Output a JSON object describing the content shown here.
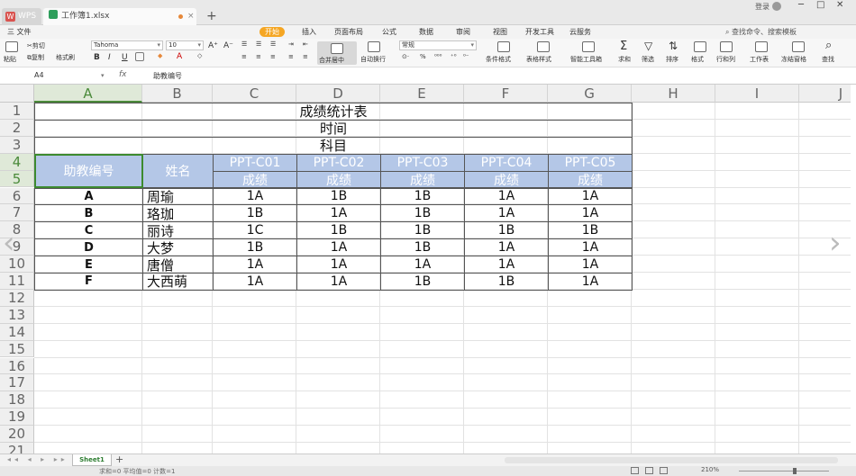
{
  "titlebar": {
    "app_tab": "WPS",
    "doc_tab": "工作簿1.xlsx",
    "login": "登录",
    "new_tab": "+"
  },
  "menu": {
    "file": "三 文件",
    "items": [
      "开始",
      "插入",
      "页面布局",
      "公式",
      "数据",
      "审阅",
      "视图",
      "开发工具",
      "云服务"
    ],
    "active": "开始",
    "search": "查找命令、搜索模板"
  },
  "toolbar": {
    "paste": "粘贴",
    "cut": "剪切",
    "copy": "复制",
    "format_painter": "格式刷",
    "font_name": "Tahoma",
    "font_size": "10",
    "merge_center": "合并居中",
    "wrap_text": "自动换行",
    "number_format": "常规",
    "cond_format": "条件格式",
    "table_style": "表格样式",
    "smart_tools": "智能工具箱",
    "sum": "求和",
    "filter": "筛选",
    "sort": "排序",
    "format": "格式",
    "rows_cols": "行和列",
    "worksheet": "工作表",
    "freeze": "冻结窗格",
    "find": "查找"
  },
  "formula_bar": {
    "cell_ref": "A4",
    "fx": "fx",
    "content": "助教编号"
  },
  "columns": [
    "A",
    "B",
    "C",
    "D",
    "E",
    "F",
    "G",
    "H",
    "I",
    "J"
  ],
  "selected_column": "A",
  "rows": [
    "1",
    "2",
    "3",
    "4",
    "5",
    "6",
    "7",
    "8",
    "9",
    "10",
    "11",
    "12",
    "13",
    "14",
    "15",
    "16",
    "17",
    "18",
    "19",
    "20",
    "21"
  ],
  "selected_rows": [
    "4",
    "5"
  ],
  "sheet": {
    "title": "成绩统计表",
    "time_label": "时间",
    "subject_label": "科目",
    "id_header": "助教编号",
    "name_header": "姓名",
    "courses": [
      "PPT-C01",
      "PPT-C02",
      "PPT-C03",
      "PPT-C04",
      "PPT-C05"
    ],
    "score_label": "成绩",
    "records": [
      {
        "id": "A",
        "name": "周瑜",
        "scores": [
          "1A",
          "1B",
          "1B",
          "1A",
          "1A"
        ]
      },
      {
        "id": "B",
        "name": "珞珈",
        "scores": [
          "1B",
          "1A",
          "1B",
          "1A",
          "1A"
        ]
      },
      {
        "id": "C",
        "name": "丽诗",
        "scores": [
          "1C",
          "1B",
          "1B",
          "1B",
          "1B"
        ]
      },
      {
        "id": "D",
        "name": "大梦",
        "scores": [
          "1B",
          "1A",
          "1B",
          "1A",
          "1A"
        ]
      },
      {
        "id": "E",
        "name": "唐僧",
        "scores": [
          "1A",
          "1A",
          "1A",
          "1A",
          "1A"
        ]
      },
      {
        "id": "F",
        "name": "大西萌",
        "scores": [
          "1A",
          "1A",
          "1B",
          "1B",
          "1A"
        ]
      }
    ]
  },
  "sheet_tabs": {
    "active": "Sheet1",
    "add": "+"
  },
  "status": {
    "summary": "求和=0  平均值=0  计数=1",
    "zoom": "210%"
  },
  "colors": {
    "accent": "#f5a623",
    "header_fill": "#b4c7e7",
    "selection": "#3c8a2e"
  }
}
